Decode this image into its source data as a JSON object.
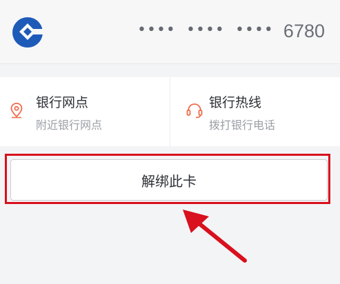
{
  "card": {
    "mask1": "••••",
    "mask2": "••••",
    "mask3": "••••",
    "last4": "6780"
  },
  "services": [
    {
      "title": "银行网点",
      "subtitle": "附近银行网点",
      "icon": "location-pin-icon"
    },
    {
      "title": "银行热线",
      "subtitle": "拨打银行电话",
      "icon": "headset-icon"
    }
  ],
  "actions": {
    "unbind_label": "解绑此卡"
  },
  "colors": {
    "brand_blue": "#1e5bb8",
    "accent_orange": "#ef6b4a",
    "highlight_red": "#d9101d"
  }
}
